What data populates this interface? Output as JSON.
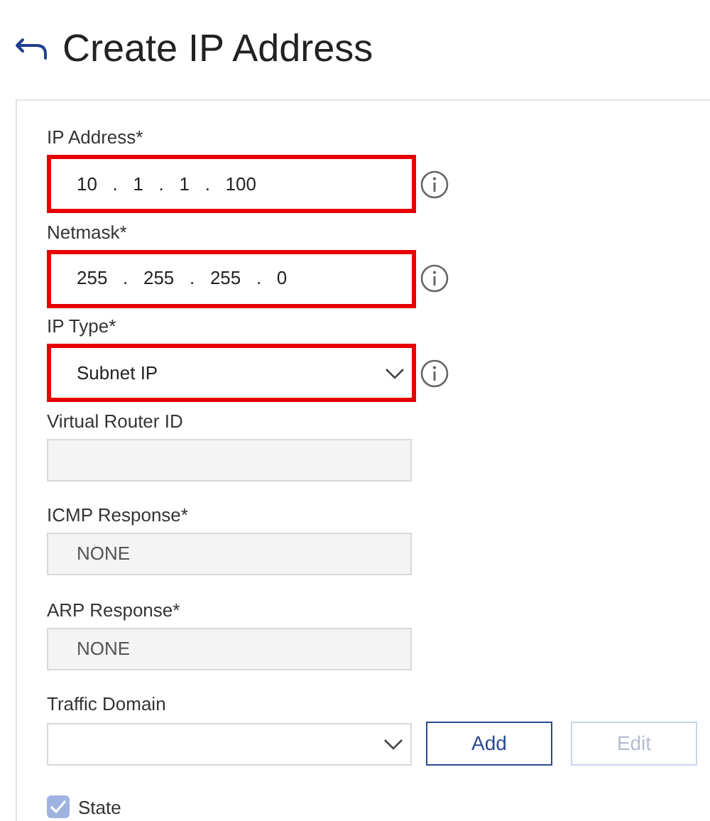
{
  "title": "Create IP Address",
  "fields": [
    {
      "kind": "ip",
      "label": "IP Address*",
      "octets": [
        "10",
        "1",
        "1",
        "100"
      ],
      "separator": ".",
      "highlighted": true,
      "info": true
    },
    {
      "kind": "ip",
      "label": "Netmask*",
      "octets": [
        "255",
        "255",
        "255",
        "0"
      ],
      "separator": ".",
      "highlighted": true,
      "info": true
    },
    {
      "kind": "select",
      "label": "IP Type*",
      "value": "Subnet IP",
      "highlighted": true,
      "info": true
    },
    {
      "kind": "readonly",
      "label": "Virtual Router ID",
      "highlighted": false,
      "info": false
    },
    {
      "kind": "readonly",
      "label": "ICMP Response*",
      "value": "NONE",
      "highlighted": false,
      "info": false
    },
    {
      "kind": "readonly",
      "label": "ARP Response*",
      "value": "NONE",
      "highlighted": false,
      "info": false
    },
    {
      "kind": "select",
      "label": "Traffic Domain",
      "highlighted": false,
      "info": false,
      "buttons": [
        {
          "label": "Add",
          "disabled": false
        },
        {
          "label": "Edit",
          "disabled": true
        }
      ]
    }
  ],
  "state_checkbox": {
    "label": "State",
    "checked": true
  }
}
